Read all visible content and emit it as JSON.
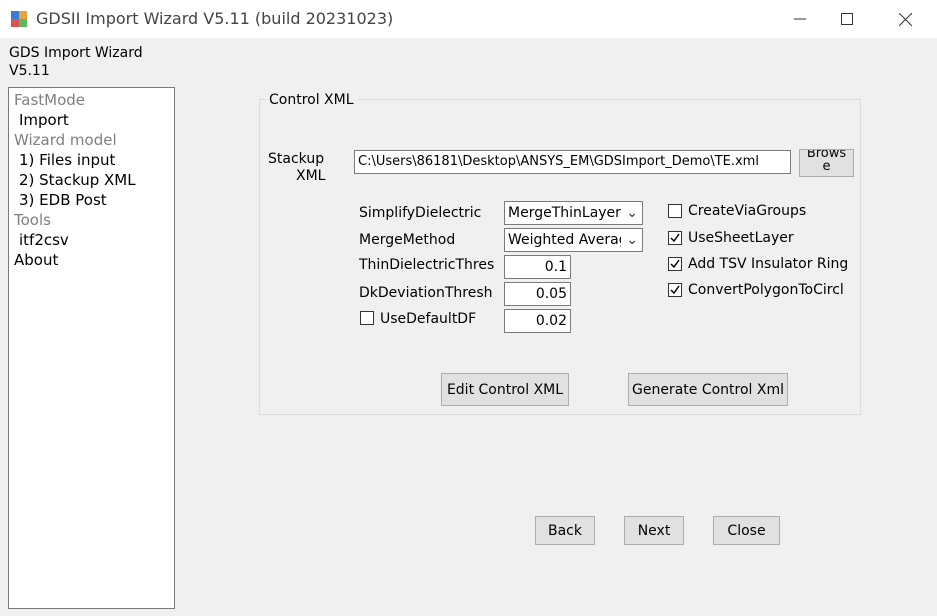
{
  "window": {
    "title": "GDSII Import Wizard V5.11 (build 20231023)",
    "minimize_icon": "minimize-icon",
    "maximize_icon": "maximize-icon",
    "close_icon": "close-icon"
  },
  "header": {
    "line1": "GDS Import Wizard",
    "line2": "V5.11"
  },
  "sidebar": {
    "items": [
      {
        "label": "FastMode",
        "kind": "group"
      },
      {
        "label": "Import",
        "kind": "item"
      },
      {
        "label": "Wizard model",
        "kind": "group"
      },
      {
        "label": "1) Files input",
        "kind": "item"
      },
      {
        "label": "2) Stackup XML",
        "kind": "item"
      },
      {
        "label": "3) EDB Post",
        "kind": "item"
      },
      {
        "label": "Tools",
        "kind": "group"
      },
      {
        "label": "itf2csv",
        "kind": "item"
      },
      {
        "label": "About",
        "kind": "item-left"
      }
    ]
  },
  "control_xml": {
    "group_title": "Control XML",
    "stackup_label_line1": "Stackup",
    "stackup_label_line2": "XML",
    "stackup_path": "C:\\Users\\86181\\Desktop\\ANSYS_EM\\GDSImport_Demo\\TE.xml",
    "browse_line1": "Brows",
    "browse_line2": "e",
    "simplify_label": "SimplifyDielectric",
    "simplify_value": "MergeThinLayer",
    "merge_label": "MergeMethod",
    "merge_value": "Weighted Average",
    "thin_label": "ThinDielectricThres",
    "thin_value": "0.1",
    "dk_label": "DkDeviationThresh",
    "dk_value": "0.05",
    "usedf_label": "UseDefaultDF",
    "usedf_checked": false,
    "usedf_value": "0.02",
    "checkboxes": [
      {
        "label": "CreateViaGroups",
        "checked": false
      },
      {
        "label": "UseSheetLayer",
        "checked": true
      },
      {
        "label": "Add TSV Insulator Ring",
        "checked": true
      },
      {
        "label": "ConvertPolygonToCircl",
        "checked": true
      }
    ],
    "edit_button": "Edit Control XML",
    "generate_button": "Generate Control Xml"
  },
  "footer": {
    "back": "Back",
    "next": "Next",
    "close": "Close"
  }
}
